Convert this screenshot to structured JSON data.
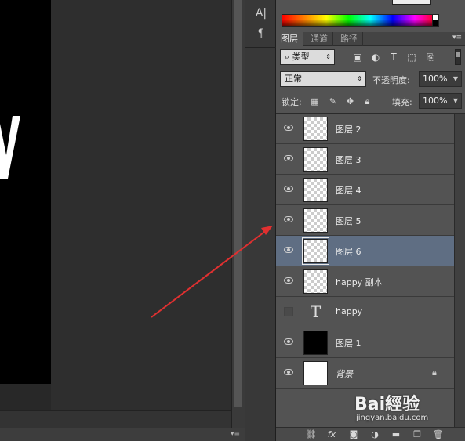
{
  "tool_dock": {
    "character_icon": "character-panel-icon",
    "paragraph_icon": "paragraph-panel-icon"
  },
  "panel_tabs": [
    {
      "label": "图层",
      "active": true
    },
    {
      "label": "通道",
      "active": false
    },
    {
      "label": "路径",
      "active": false
    }
  ],
  "filter": {
    "kind_label": "类型",
    "icons": [
      "image-filter-icon",
      "adjustment-filter-icon",
      "type-filter-icon",
      "shape-filter-icon",
      "smart-object-filter-icon"
    ]
  },
  "blend": {
    "mode": "正常",
    "opacity_label": "不透明度:",
    "opacity_value": "100%"
  },
  "lock": {
    "label": "锁定:",
    "fill_label": "填充:",
    "fill_value": "100%"
  },
  "layers": [
    {
      "name": "图层 2",
      "visible": true,
      "thumb": "transparent",
      "selected": false
    },
    {
      "name": "图层 3",
      "visible": true,
      "thumb": "transparent",
      "selected": false
    },
    {
      "name": "图层 4",
      "visible": true,
      "thumb": "transparent",
      "selected": false
    },
    {
      "name": "图层 5",
      "visible": true,
      "thumb": "transparent",
      "selected": false
    },
    {
      "name": "图层 6",
      "visible": true,
      "thumb": "transparent",
      "selected": true
    },
    {
      "name": "happy 副本",
      "visible": true,
      "thumb": "transparent",
      "selected": false
    },
    {
      "name": "happy",
      "visible": false,
      "thumb": "type",
      "type_glyph": "T",
      "selected": false
    },
    {
      "name": "图层 1",
      "visible": true,
      "thumb": "black",
      "selected": false
    },
    {
      "name": "背景",
      "visible": true,
      "thumb": "white",
      "selected": false,
      "locked": true
    }
  ],
  "footer_icons": [
    "link-layers-icon",
    "fx-icon",
    "add-mask-icon",
    "adjustment-layer-icon",
    "group-folder-icon",
    "new-layer-icon",
    "trash-icon"
  ],
  "footer": {
    "fx_label": "fx"
  },
  "watermark": {
    "logo": "Bai經验",
    "url": "jingyan.baidu.com"
  },
  "colors": {
    "selected_row": "#5f6e83",
    "panel_bg": "#535353",
    "arrow": "#e03030"
  }
}
